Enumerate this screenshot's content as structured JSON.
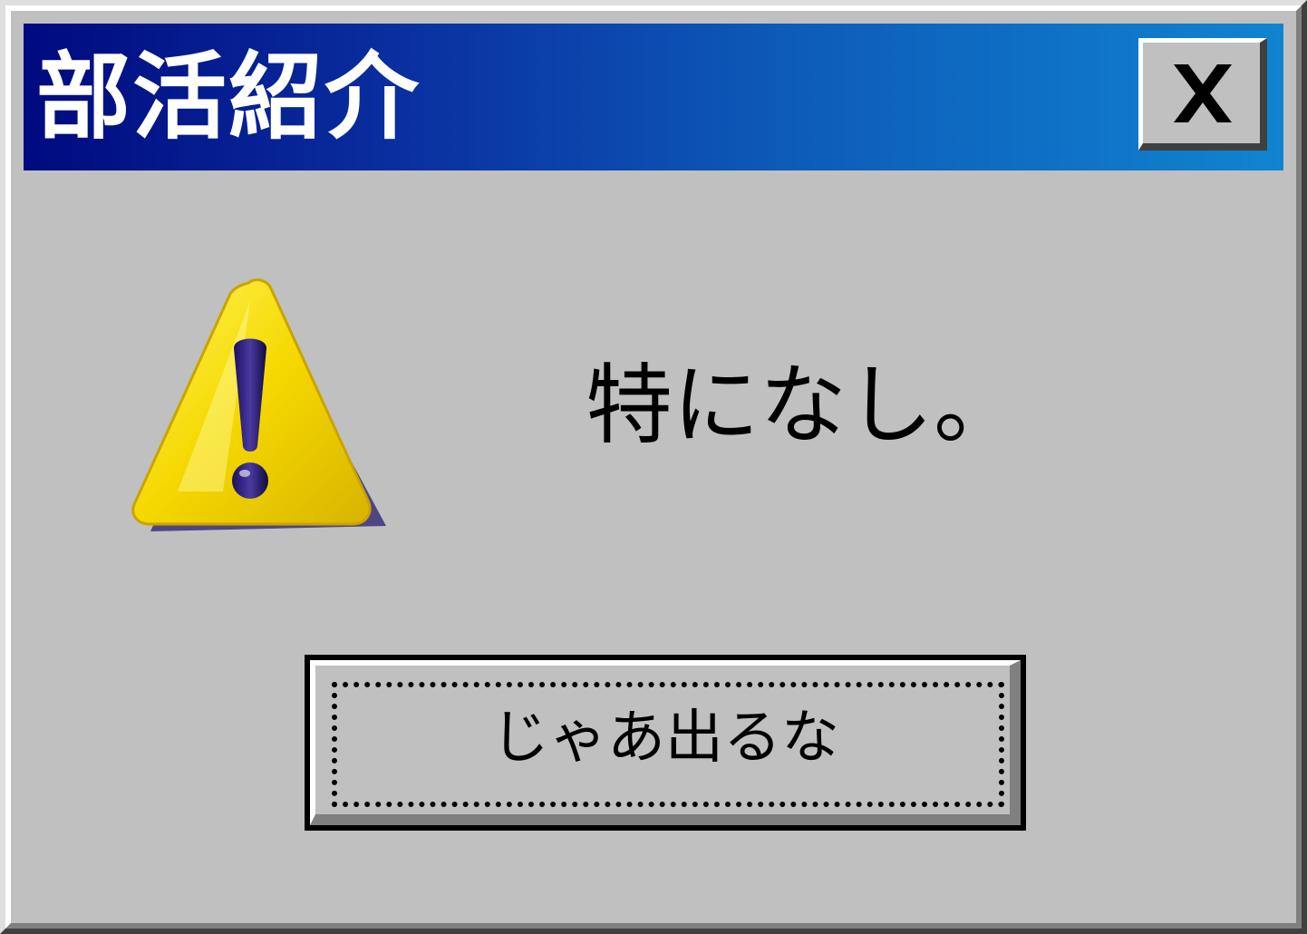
{
  "window": {
    "title": "部活紹介"
  },
  "message": {
    "icon": "warning-icon",
    "text": "特になし。"
  },
  "buttons": {
    "close_icon": "close-icon",
    "ok_label": "じゃあ出るな"
  },
  "colors": {
    "face": "#c0c0c0",
    "title_gradient_start": "#000a7f",
    "title_gradient_end": "#1084d0",
    "title_text": "#ffffff",
    "warning_yellow": "#f5d800",
    "warning_outline": "#3a2e80"
  }
}
